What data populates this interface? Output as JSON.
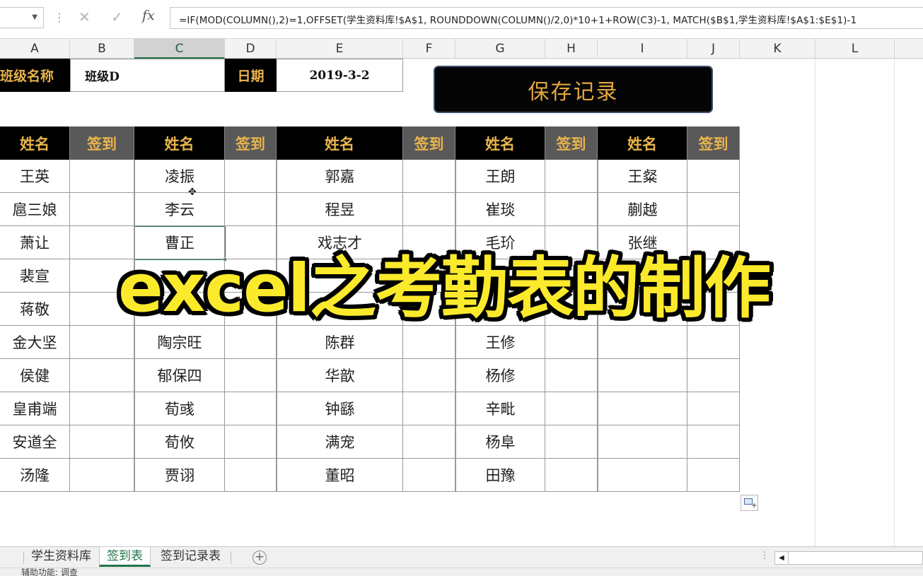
{
  "formula_bar": {
    "name_box": "",
    "formula": "=IF(MOD(COLUMN(),2)=1,OFFSET(学生资料库!$A$1, ROUNDDOWN(COLUMN()/2,0)*10+1+ROW(C3)-1,  MATCH($B$1,学生资料库!$A$1:$E$1)-1"
  },
  "column_headers": [
    "A",
    "B",
    "C",
    "D",
    "E",
    "F",
    "G",
    "H",
    "I",
    "J",
    "K",
    "L"
  ],
  "selected_column": "C",
  "info_row": {
    "class_label": "班级名称",
    "class_value": "班级D",
    "date_label": "日期",
    "date_value": "2019-3-2"
  },
  "save_button": "保存记录",
  "table": {
    "name_header": "姓名",
    "sign_header": "签到",
    "groups": [
      [
        "王英",
        "扈三娘",
        "萧让",
        "裴宣",
        "蒋敬",
        "金大坚",
        "侯健",
        "皇甫端",
        "安道全",
        "汤隆"
      ],
      [
        "凌振",
        "李云",
        "曹正",
        "",
        "",
        "陶宗旺",
        "郁保四",
        "荀彧",
        "荀攸",
        "贾诩"
      ],
      [
        "郭嘉",
        "程昱",
        "戏志才",
        "",
        "",
        "陈群",
        "华歆",
        "钟繇",
        "满宠",
        "董昭"
      ],
      [
        "王朗",
        "崔琰",
        "毛玠",
        "",
        "",
        "王修",
        "杨修",
        "辛毗",
        "杨阜",
        "田豫"
      ],
      [
        "王粲",
        "蒯越",
        "张继",
        "",
        "",
        "",
        "",
        "",
        "",
        ""
      ]
    ]
  },
  "overlay_title": "excel之考勤表的制作",
  "sheet_tabs": [
    "学生资料库",
    "签到表",
    "签到记录表"
  ],
  "active_tab": "签到表",
  "status_text": "辅助功能: 调查"
}
